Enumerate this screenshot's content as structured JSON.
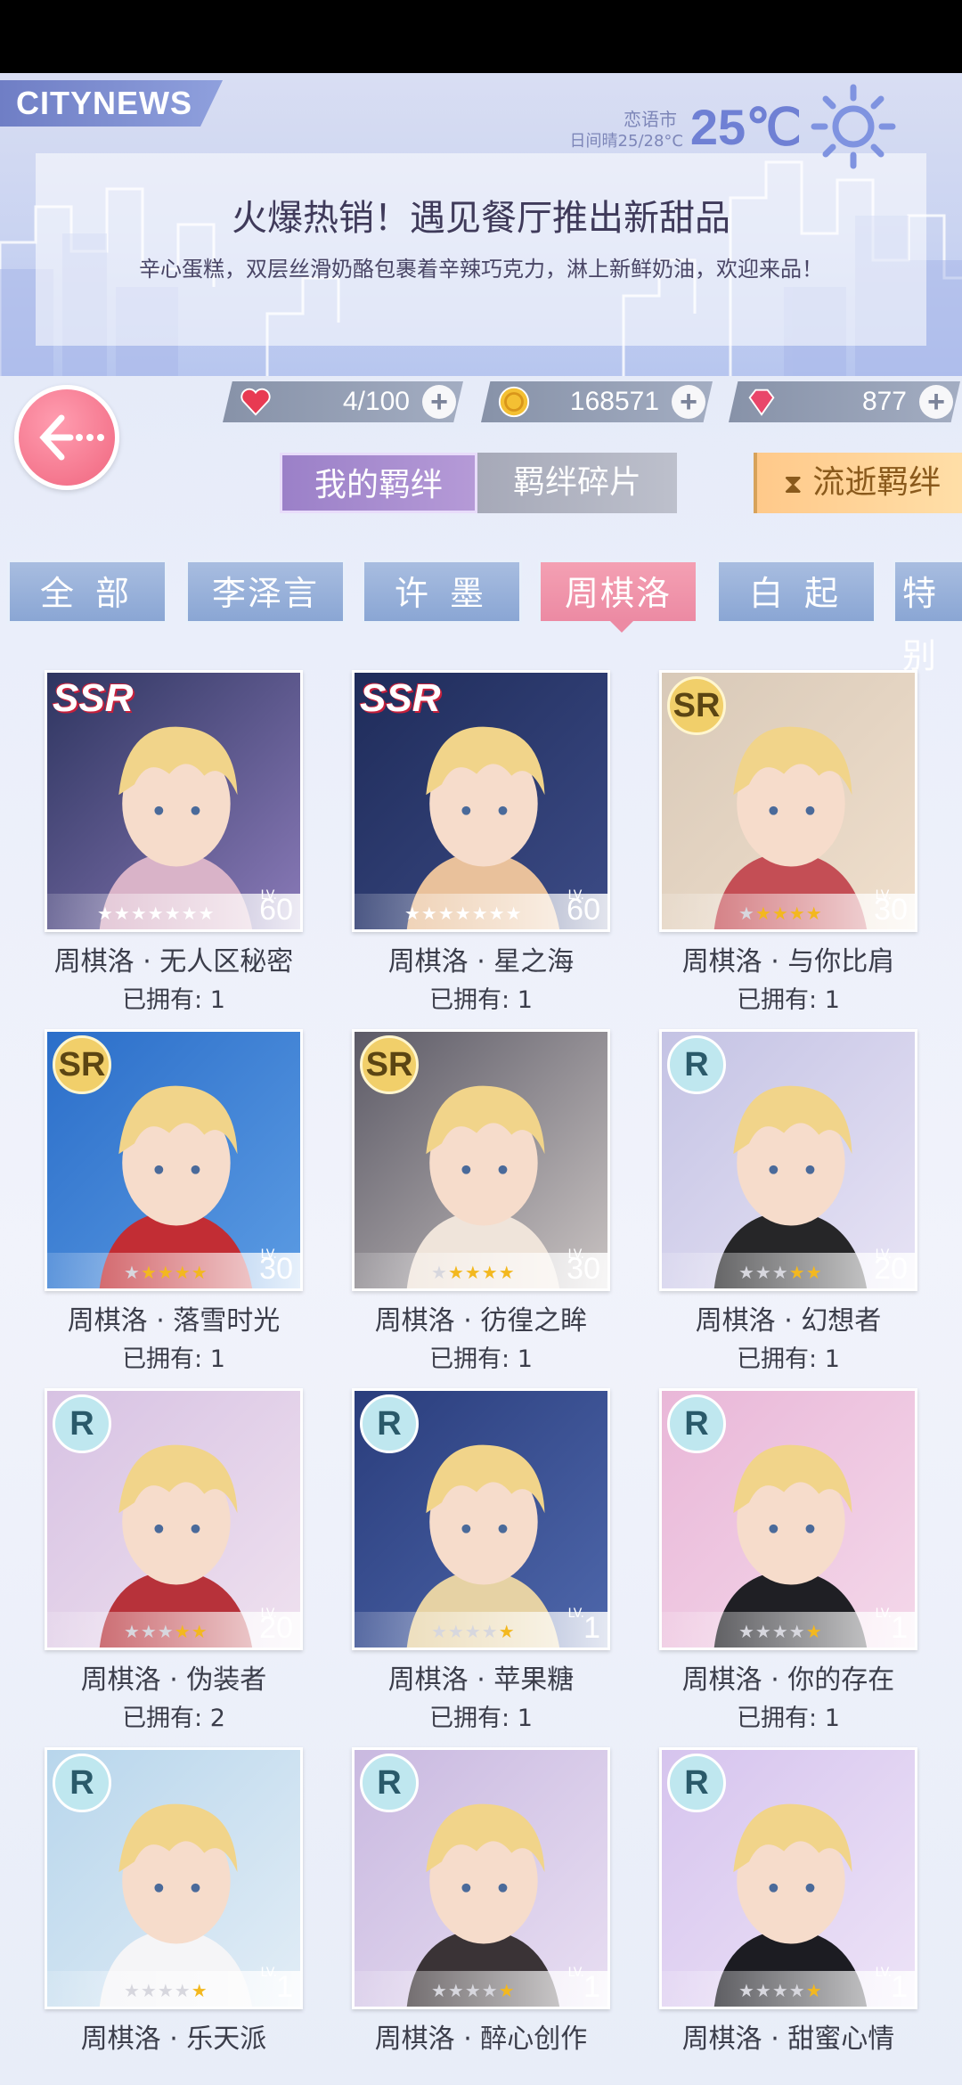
{
  "news": {
    "tag": "CITYNEWS",
    "city": "恋语市",
    "weather_range": "日间晴25/28°C",
    "temperature": "25℃",
    "title": "火爆热销！遇见餐厅推出新甜品",
    "subtitle": "辛心蛋糕，双层丝滑奶酪包裹着辛辣巧克力，淋上新鲜奶油，欢迎来品！"
  },
  "currency": {
    "stamina": "4/100",
    "coins": "168571",
    "diamonds": "877"
  },
  "top_tabs": [
    "我的羁绊",
    "羁绊碎片",
    "流逝羁绊"
  ],
  "char_tabs": [
    "全 部",
    "李泽言",
    "许 墨",
    "周棋洛",
    "白 起",
    "特别"
  ],
  "active_char_tab": "周棋洛",
  "owned_prefix": "已拥有: ",
  "cards": [
    {
      "name": "周棋洛 · 无人区秘密",
      "owned": "已拥有: 1",
      "rarity": "SSR",
      "level": "60",
      "stars": 7,
      "stars_on": 7,
      "colors": [
        "#2e3560",
        "#8a7ab8",
        "#d9b3c8"
      ]
    },
    {
      "name": "周棋洛 · 星之海",
      "owned": "已拥有: 1",
      "rarity": "SSR",
      "level": "60",
      "stars": 7,
      "stars_on": 7,
      "colors": [
        "#1f2c5a",
        "#3c4b86",
        "#e9c19b"
      ]
    },
    {
      "name": "周棋洛 · 与你比肩",
      "owned": "已拥有: 1",
      "rarity": "SR",
      "level": "30",
      "stars": 5,
      "stars_on": 4,
      "colors": [
        "#d8c9b8",
        "#f0dfcc",
        "#c44e55"
      ]
    },
    {
      "name": "周棋洛 · 落雪时光",
      "owned": "已拥有: 1",
      "rarity": "SR",
      "level": "30",
      "stars": 5,
      "stars_on": 4,
      "colors": [
        "#2b6ec9",
        "#5b9be3",
        "#c22d34"
      ]
    },
    {
      "name": "周棋洛 · 彷徨之眸",
      "owned": "已拥有: 1",
      "rarity": "SR",
      "level": "30",
      "stars": 5,
      "stars_on": 4,
      "colors": [
        "#5c5a66",
        "#c9c3c2",
        "#efe4da"
      ]
    },
    {
      "name": "周棋洛 · 幻想者",
      "owned": "已拥有: 1",
      "rarity": "R",
      "level": "20",
      "stars": 5,
      "stars_on": 2,
      "colors": [
        "#c4c3e4",
        "#e7e3f5",
        "#262628"
      ]
    },
    {
      "name": "周棋洛 · 伪装者",
      "owned": "已拥有: 2",
      "rarity": "R",
      "level": "20",
      "stars": 5,
      "stars_on": 2,
      "colors": [
        "#d7c2e3",
        "#efe1ef",
        "#b7323a"
      ]
    },
    {
      "name": "周棋洛 · 苹果糖",
      "owned": "已拥有: 1",
      "rarity": "R",
      "level": "1",
      "stars": 5,
      "stars_on": 1,
      "colors": [
        "#2a3d7c",
        "#4e67ab",
        "#e6d2a4"
      ]
    },
    {
      "name": "周棋洛 · 你的存在",
      "owned": "已拥有: 1",
      "rarity": "R",
      "level": "1",
      "stars": 5,
      "stars_on": 1,
      "colors": [
        "#e9b7d8",
        "#f4d8ea",
        "#1f1f24"
      ]
    },
    {
      "name": "周棋洛 · 乐天派",
      "owned": "",
      "rarity": "R",
      "level": "1",
      "stars": 5,
      "stars_on": 1,
      "colors": [
        "#b8d6ec",
        "#e2edf6",
        "#f5f5f7"
      ]
    },
    {
      "name": "周棋洛 · 醉心创作",
      "owned": "",
      "rarity": "R",
      "level": "1",
      "stars": 5,
      "stars_on": 1,
      "colors": [
        "#c9b9e0",
        "#e8def2",
        "#3a3336"
      ]
    },
    {
      "name": "周棋洛 · 甜蜜心情",
      "owned": "",
      "rarity": "R",
      "level": "1",
      "stars": 5,
      "stars_on": 1,
      "colors": [
        "#d6c4ee",
        "#ede3f7",
        "#1c1c22"
      ]
    }
  ],
  "colors": {
    "accent_pink": "#ec8aa3",
    "tab_blue": "#8aa6d4",
    "tab_purple": "#9b80c8"
  }
}
